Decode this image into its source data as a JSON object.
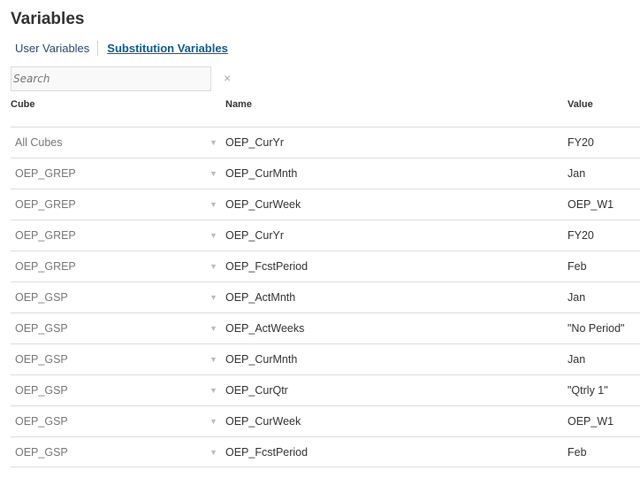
{
  "title": "Variables",
  "tabs": {
    "user": "User Variables",
    "substitution": "Substitution Variables"
  },
  "search": {
    "placeholder": "Search",
    "clear": "×"
  },
  "columns": {
    "cube": "Cube",
    "name": "Name",
    "value": "Value"
  },
  "rows": [
    {
      "cube": "All Cubes",
      "name": "OEP_CurYr",
      "value": "FY20"
    },
    {
      "cube": "OEP_GREP",
      "name": "OEP_CurMnth",
      "value": "Jan"
    },
    {
      "cube": "OEP_GREP",
      "name": "OEP_CurWeek",
      "value": "OEP_W1"
    },
    {
      "cube": "OEP_GREP",
      "name": "OEP_CurYr",
      "value": "FY20"
    },
    {
      "cube": "OEP_GREP",
      "name": "OEP_FcstPeriod",
      "value": "Feb"
    },
    {
      "cube": "OEP_GSP",
      "name": "OEP_ActMnth",
      "value": "Jan"
    },
    {
      "cube": "OEP_GSP",
      "name": "OEP_ActWeeks",
      "value": "\"No Period\""
    },
    {
      "cube": "OEP_GSP",
      "name": "OEP_CurMnth",
      "value": "Jan"
    },
    {
      "cube": "OEP_GSP",
      "name": "OEP_CurQtr",
      "value": "\"Qtrly 1\""
    },
    {
      "cube": "OEP_GSP",
      "name": "OEP_CurWeek",
      "value": "OEP_W1"
    },
    {
      "cube": "OEP_GSP",
      "name": "OEP_FcstPeriod",
      "value": "Feb"
    }
  ]
}
